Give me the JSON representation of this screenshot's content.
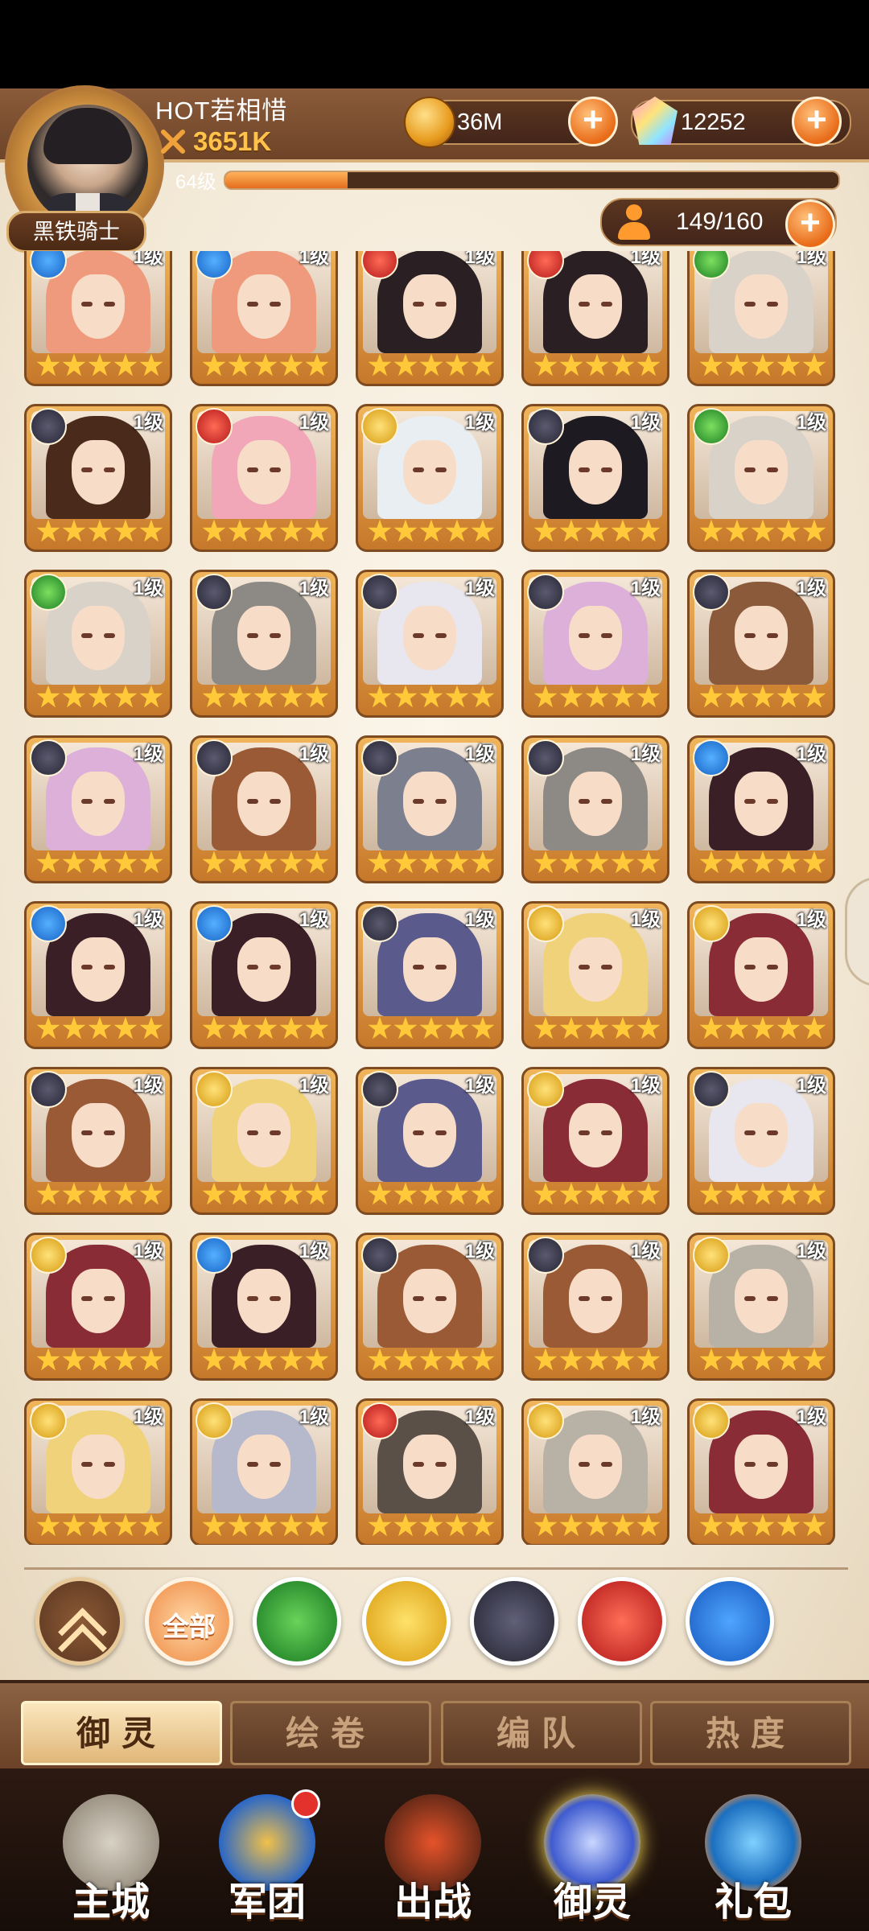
{
  "player": {
    "name": "HOT若相惜",
    "power": "3651K",
    "level_label": "64级",
    "xp_fraction": 0.2,
    "title": "黑铁骑士"
  },
  "resources": {
    "gold": "36M",
    "gems": "12252",
    "capacity": "149/160"
  },
  "colors": {
    "accent": "#e86b18",
    "header": "#7a4d30",
    "card_frame": "#c6782a",
    "star": "#ffc93a"
  },
  "heroes": [
    {
      "element": "water",
      "level": "1级",
      "stars": 5,
      "hair": "#f09a7d"
    },
    {
      "element": "water",
      "level": "1级",
      "stars": 5,
      "hair": "#f09a7d"
    },
    {
      "element": "fire",
      "level": "1级",
      "stars": 5,
      "hair": "#2a1f22"
    },
    {
      "element": "fire",
      "level": "1级",
      "stars": 5,
      "hair": "#2a1f22"
    },
    {
      "element": "wind",
      "level": "1级",
      "stars": 5,
      "hair": "#d9d2c8"
    },
    {
      "element": "dark",
      "level": "1级",
      "stars": 5,
      "hair": "#4a2a1a"
    },
    {
      "element": "fire",
      "level": "1级",
      "stars": 5,
      "hair": "#f1a7b8"
    },
    {
      "element": "light",
      "level": "1级",
      "stars": 5,
      "hair": "#e9eef2"
    },
    {
      "element": "dark",
      "level": "1级",
      "stars": 5,
      "hair": "#1d1a22"
    },
    {
      "element": "wind",
      "level": "1级",
      "stars": 5,
      "hair": "#d9d2c8"
    },
    {
      "element": "wind",
      "level": "1级",
      "stars": 5,
      "hair": "#d9d2c8"
    },
    {
      "element": "dark",
      "level": "1级",
      "stars": 5,
      "hair": "#8d8a86"
    },
    {
      "element": "dark",
      "level": "1级",
      "stars": 5,
      "hair": "#e8e6ee"
    },
    {
      "element": "dark",
      "level": "1级",
      "stars": 5,
      "hair": "#dcb0d8"
    },
    {
      "element": "dark",
      "level": "1级",
      "stars": 5,
      "hair": "#8a5a3a"
    },
    {
      "element": "dark",
      "level": "1级",
      "stars": 5,
      "hair": "#dcb0d8"
    },
    {
      "element": "dark",
      "level": "1级",
      "stars": 5,
      "hair": "#9b5a36"
    },
    {
      "element": "dark",
      "level": "1级",
      "stars": 5,
      "hair": "#7c7f8e"
    },
    {
      "element": "dark",
      "level": "1级",
      "stars": 5,
      "hair": "#8d8a86"
    },
    {
      "element": "water",
      "level": "1级",
      "stars": 5,
      "hair": "#3b1f26"
    },
    {
      "element": "water",
      "level": "1级",
      "stars": 5,
      "hair": "#3b1f26"
    },
    {
      "element": "water",
      "level": "1级",
      "stars": 5,
      "hair": "#3b1f26"
    },
    {
      "element": "dark",
      "level": "1级",
      "stars": 5,
      "hair": "#5a5a8c"
    },
    {
      "element": "light",
      "level": "1级",
      "stars": 5,
      "hair": "#f0d27a"
    },
    {
      "element": "light",
      "level": "1级",
      "stars": 5,
      "hair": "#8a2c36"
    },
    {
      "element": "dark",
      "level": "1级",
      "stars": 5,
      "hair": "#9b5a36"
    },
    {
      "element": "light",
      "level": "1级",
      "stars": 5,
      "hair": "#f0d27a"
    },
    {
      "element": "dark",
      "level": "1级",
      "stars": 5,
      "hair": "#5a5a8c"
    },
    {
      "element": "light",
      "level": "1级",
      "stars": 5,
      "hair": "#8a2c36"
    },
    {
      "element": "dark",
      "level": "1级",
      "stars": 5,
      "hair": "#e8e6ee"
    },
    {
      "element": "light",
      "level": "1级",
      "stars": 5,
      "hair": "#8a2c36"
    },
    {
      "element": "water",
      "level": "1级",
      "stars": 5,
      "hair": "#3b1f26"
    },
    {
      "element": "dark",
      "level": "1级",
      "stars": 5,
      "hair": "#9b5a36"
    },
    {
      "element": "dark",
      "level": "1级",
      "stars": 5,
      "hair": "#9b5a36"
    },
    {
      "element": "light",
      "level": "1级",
      "stars": 5,
      "hair": "#b8b2a6"
    },
    {
      "element": "light",
      "level": "1级",
      "stars": 5,
      "hair": "#f0d27a"
    },
    {
      "element": "light",
      "level": "1级",
      "stars": 5,
      "hair": "#b6b8cc"
    },
    {
      "element": "fire",
      "level": "1级",
      "stars": 5,
      "hair": "#5a5048"
    },
    {
      "element": "light",
      "level": "1级",
      "stars": 5,
      "hair": "#b8b2a6"
    },
    {
      "element": "light",
      "level": "1级",
      "stars": 5,
      "hair": "#8a2c36"
    }
  ],
  "filters": {
    "all_label": "全部",
    "items": [
      "collapse",
      "all",
      "wind",
      "light",
      "dark",
      "fire",
      "water"
    ]
  },
  "tabs": [
    "御灵",
    "绘卷",
    "编队",
    "热度"
  ],
  "nav": [
    "主城",
    "军团",
    "出战",
    "御灵",
    "礼包"
  ]
}
